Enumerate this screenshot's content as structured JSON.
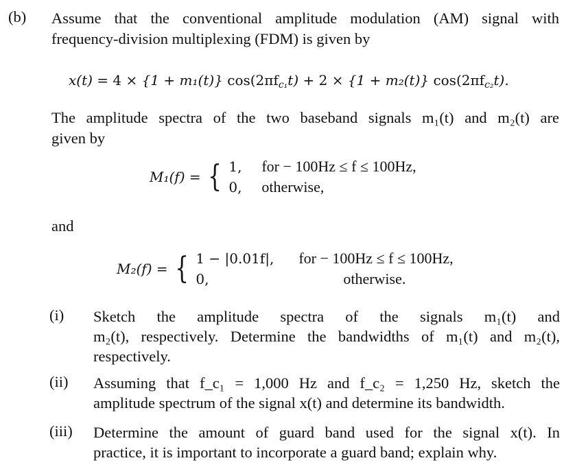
{
  "part_label": "(b)",
  "intro_line1": "Assume that the conventional amplitude modulation (AM) signal with",
  "intro_line2": "frequency-division multiplexing (FDM) is given by",
  "equation_x": {
    "lhs": "x(t)",
    "eq": "=",
    "term1_coef": "4 ×",
    "term1_body": "{1 + m₁(t)}",
    "term1_cos": "cos(2πf",
    "term1_sub": "c₁",
    "term1_end": "t)",
    "plus": "+",
    "term2_coef": "2 ×",
    "term2_body": "{1 + m₂(t)}",
    "term2_cos": "cos(2πf",
    "term2_sub": "c₂",
    "term2_end": "t)."
  },
  "spectra_line1": "The amplitude spectra of the two baseband signals m₁(t) and m₂(t) are",
  "spectra_line2": "given by",
  "M1": {
    "lhs": "M₁(f) =",
    "case1_value": "1,",
    "case1_cond": "for − 100Hz ≤ f ≤ 100Hz,",
    "case2_value": "0,",
    "case2_cond": "otherwise,"
  },
  "and_text": "and",
  "M2": {
    "lhs": "M₂(f) =",
    "case1_value": "1 − |0.01f|,",
    "case1_cond": "for − 100Hz ≤ f ≤ 100Hz,",
    "case2_value": "0,",
    "case2_cond": "otherwise."
  },
  "questions": [
    {
      "label": "(i)",
      "lines": [
        "Sketch the amplitude spectra of the signals m₁(t) and",
        "m₂(t), respectively. Determine the bandwidths of m₁(t) and m₂(t),",
        "respectively."
      ]
    },
    {
      "label": "(ii)",
      "lines": [
        "Assuming that f_c₁ = 1,000 Hz and f_c₂ = 1,250 Hz, sketch the",
        "amplitude spectrum of the signal x(t) and determine its bandwidth."
      ]
    },
    {
      "label": "(iii)",
      "lines": [
        "Determine the amount of guard band used for the signal x(t). In",
        "practice, it is important to incorporate a guard band; explain why."
      ]
    }
  ]
}
